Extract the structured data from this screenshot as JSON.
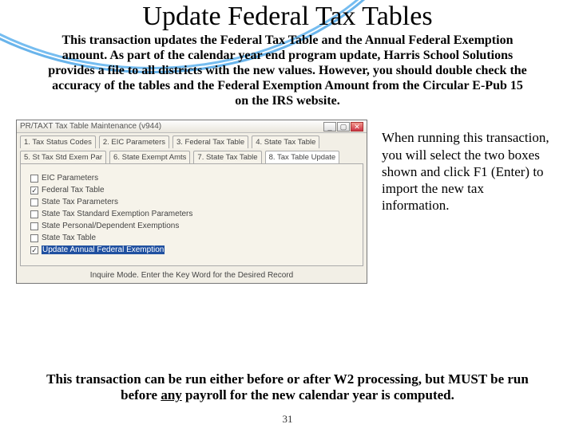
{
  "title": "Update Federal Tax Tables",
  "intro": "This transaction updates the Federal Tax Table and the Annual Federal Exemption amount.  As part of the calendar year end program update, Harris School Solutions provides a file to all districts with the new values.  However, you should double check the accuracy of the tables and the Federal Exemption Amount from the Circular E-Pub 15 on the IRS website.",
  "screenshot": {
    "window_title": "PR/TAXT Tax Table Maintenance (v944)",
    "tabs_row1": [
      "1. Tax Status Codes",
      "2. EIC Parameters",
      "3. Federal Tax Table",
      "4. State Tax Table"
    ],
    "tabs_row2": [
      "5. St Tax Std Exem Par",
      "6. State Exempt Amts",
      "7. State Tax Table",
      "8. Tax Table Update"
    ],
    "active_tab_index_row2": 3,
    "checkboxes": [
      {
        "label": "EIC Parameters",
        "checked": false
      },
      {
        "label": "Federal Tax Table",
        "checked": true
      },
      {
        "label": "State Tax Parameters",
        "checked": false
      },
      {
        "label": "State Tax Standard Exemption Parameters",
        "checked": false
      },
      {
        "label": "State Personal/Dependent Exemptions",
        "checked": false
      },
      {
        "label": "State Tax Table",
        "checked": false
      },
      {
        "label": "Update Annual Federal Exemption",
        "checked": true,
        "highlighted": true
      }
    ],
    "status_line": "Inquire Mode. Enter the Key Word for the Desired Record"
  },
  "side_paragraph": "When running this transaction, you will select the two boxes shown and click F1 (Enter) to import the new tax information.",
  "closing_lead": "This transaction can be run either before or after W2 processing, but MUST be run before ",
  "closing_underlined": "any",
  "closing_tail": " payroll for the new calendar year is computed.",
  "page_number": "31"
}
